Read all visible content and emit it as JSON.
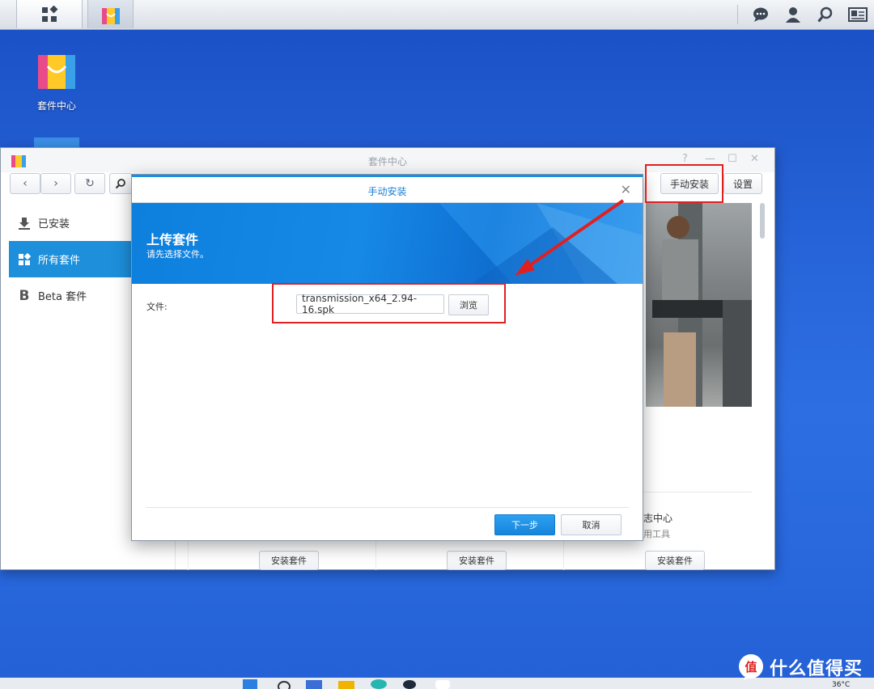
{
  "desktop": {
    "icon_label": "套件中心"
  },
  "window": {
    "title": "套件中心",
    "toolbar": {
      "manual_install": "手动安装",
      "settings": "设置"
    },
    "sidebar": [
      {
        "label": "已安装",
        "icon": "download-icon"
      },
      {
        "label": "所有套件",
        "icon": "grid-icon"
      },
      {
        "label": "Beta 套件",
        "icon": "beta-icon"
      }
    ],
    "packages": [
      {
        "install_label": "安装套件"
      },
      {
        "install_label": "安装套件"
      },
      {
        "install_label": "安装套件",
        "name_partial": "志中心",
        "desc_partial": "用工具"
      }
    ]
  },
  "modal": {
    "title": "手动安装",
    "banner_title": "上传套件",
    "banner_subtitle": "请先选择文件。",
    "file_label": "文件:",
    "file_value": "transmission_x64_2.94-16.spk",
    "browse_label": "浏览",
    "next_label": "下一步",
    "cancel_label": "取消"
  },
  "watermark": {
    "text": "什么值得买",
    "badge": "值"
  },
  "tray": {
    "temperature": "36°C"
  },
  "colors": {
    "desktop": "#2663d8",
    "accent": "#1a8fe0",
    "annotation": "#e02020"
  }
}
